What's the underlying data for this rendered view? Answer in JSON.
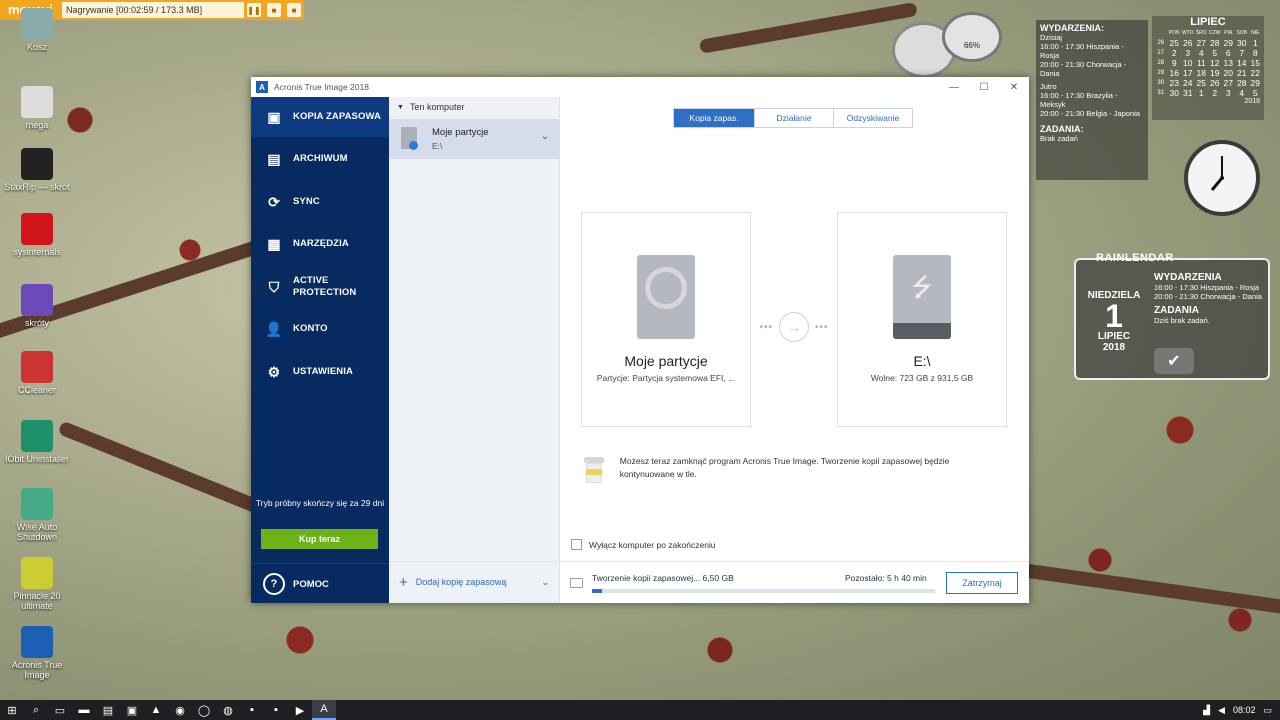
{
  "recorder": {
    "logo": "movavi",
    "status": "Nagrywanie  [00:02:59 / 173.3 MB]"
  },
  "desktop_icons": [
    {
      "label": "Kosz",
      "icon": "recycle-bin-icon",
      "color": "#8aa"
    },
    {
      "label": "mega",
      "icon": "mega-icon",
      "color": "#ddd"
    },
    {
      "label": "StaxRip — skrót",
      "icon": "staxrip-icon",
      "color": "#222"
    },
    {
      "label": "sysinternals",
      "icon": "opera-icon",
      "color": "#d0161b"
    },
    {
      "label": "skróty",
      "icon": "folder-icon",
      "color": "#6a4ab8"
    },
    {
      "label": "CCleaner",
      "icon": "ccleaner-icon",
      "color": "#c33"
    },
    {
      "label": "IObit Uninstaller",
      "icon": "iobit-icon",
      "color": "#1e8f6b"
    },
    {
      "label": "Wise Auto Shutdown",
      "icon": "shutdown-icon",
      "color": "#4a8"
    },
    {
      "label": "Pinnacle 20 ultimate",
      "icon": "pinnacle-icon",
      "color": "#cc3"
    },
    {
      "label": "Acronis True Image",
      "icon": "acronis-icon",
      "color": "#1d5fb4"
    }
  ],
  "widgets": {
    "events": {
      "header": "WYDARZENIA:",
      "today": "Dzisiaj",
      "today_items": [
        "16:00 - 17:30 Hiszpania - Rosja",
        "20:00 - 21:30 Chorwacja - Dania"
      ],
      "tomorrow": "Jutro",
      "tomorrow_items": [
        "16:00 - 17:30 Brazylia - Meksyk",
        "20:00 - 21:30 Belgia - Japonia"
      ],
      "tasks_header": "ZADANIA:",
      "tasks": "Brak zadań"
    },
    "calendar": {
      "month": "LIPIEC",
      "year": "2018",
      "days_header": [
        "",
        "PON",
        "WTO",
        "ŚRO",
        "CZW",
        "PIĄ",
        "SOB",
        "NIE"
      ],
      "rows": [
        [
          "26",
          "25",
          "26",
          "27",
          "28",
          "29",
          "30",
          "1"
        ],
        [
          "27",
          "2",
          "3",
          "4",
          "5",
          "6",
          "7",
          "8"
        ],
        [
          "28",
          "9",
          "10",
          "11",
          "12",
          "13",
          "14",
          "15"
        ],
        [
          "29",
          "16",
          "17",
          "18",
          "19",
          "20",
          "21",
          "22"
        ],
        [
          "30",
          "23",
          "24",
          "25",
          "26",
          "27",
          "28",
          "29"
        ],
        [
          "31",
          "30",
          "31",
          "1",
          "2",
          "3",
          "4",
          "5"
        ]
      ]
    },
    "gauge": {
      "value": "66%"
    },
    "rainlendar": {
      "title": "RAINLENDAR",
      "weekday": "NIEDZIELA",
      "day": "1",
      "month": "LIPIEC",
      "year": "2018",
      "events_header": "WYDARZENIA",
      "events": [
        "16:00 - 17:30 Hiszpania - Rosja",
        "20:00 - 21:30 Chorwacja - Dania"
      ],
      "tasks_header": "ZADANIA",
      "tasks": "Dziś brak zadań."
    }
  },
  "taskbar": {
    "time": "08:02",
    "items": [
      "start-icon",
      "search-icon",
      "task-view-icon",
      "file-explorer-icon",
      "store-icon",
      "save-icon",
      "vlc-icon",
      "chrome-icon",
      "opera-icon",
      "firefox-icon",
      "app-icon",
      "app-icon",
      "media-icon",
      "acronis-icon"
    ]
  },
  "app": {
    "title": "Acronis True Image 2018",
    "window_controls": [
      "—",
      "☐",
      "✕"
    ],
    "nav": [
      {
        "label": "KOPIA ZAPASOWA",
        "icon": "backup-icon",
        "glyph": "▣",
        "active": true
      },
      {
        "label": "ARCHIWUM",
        "icon": "archive-icon",
        "glyph": "▤",
        "active": false
      },
      {
        "label": "SYNC",
        "icon": "sync-icon",
        "glyph": "⟳",
        "active": false
      },
      {
        "label": "NARZĘDZIA",
        "icon": "tools-icon",
        "glyph": "▦",
        "active": false
      },
      {
        "label": "ACTIVE PROTECTION",
        "label1": "ACTIVE",
        "label2": "PROTECTION",
        "icon": "shield-icon",
        "glyph": "⛉",
        "active": false
      },
      {
        "label": "KONTO",
        "icon": "user-icon",
        "glyph": "👤",
        "active": false
      },
      {
        "label": "USTAWIENIA",
        "icon": "settings-icon",
        "glyph": "⚙",
        "active": false
      }
    ],
    "trial_text": "Tryb próbny skończy się za 29 dni",
    "buy_label": "Kup teraz",
    "help_label": "POMOC",
    "source_header": "Ten komputer",
    "source_item": {
      "name": "Moje partycje",
      "dest": "E:\\"
    },
    "add_backup": "Dodaj kopię zapasową",
    "tabs": [
      {
        "label": "Kopia zapas.",
        "active": true
      },
      {
        "label": "Działanie",
        "active": false
      },
      {
        "label": "Odzyskiwanie",
        "active": false
      }
    ],
    "source_card": {
      "title": "Moje partycje",
      "subtitle": "Partycje: Partycja systemowa EFI, ..."
    },
    "dest_card": {
      "title": "E:\\",
      "subtitle": "Wolne: 723 GB z 931,5 GB"
    },
    "info_text": "Możesz teraz zamknąć program Acronis True Image. Tworzenie kopii zapasowej będzie kontynuowane w tle.",
    "shutdown_label": "Wyłącz komputer po zakończeniu",
    "progress": {
      "label": "Tworzenie kopii zapasowej...  6,50 GB",
      "remaining": "Pozostało: 5 h 40 min",
      "fraction": 0.03
    },
    "stop_label": "Zatrzymaj"
  }
}
